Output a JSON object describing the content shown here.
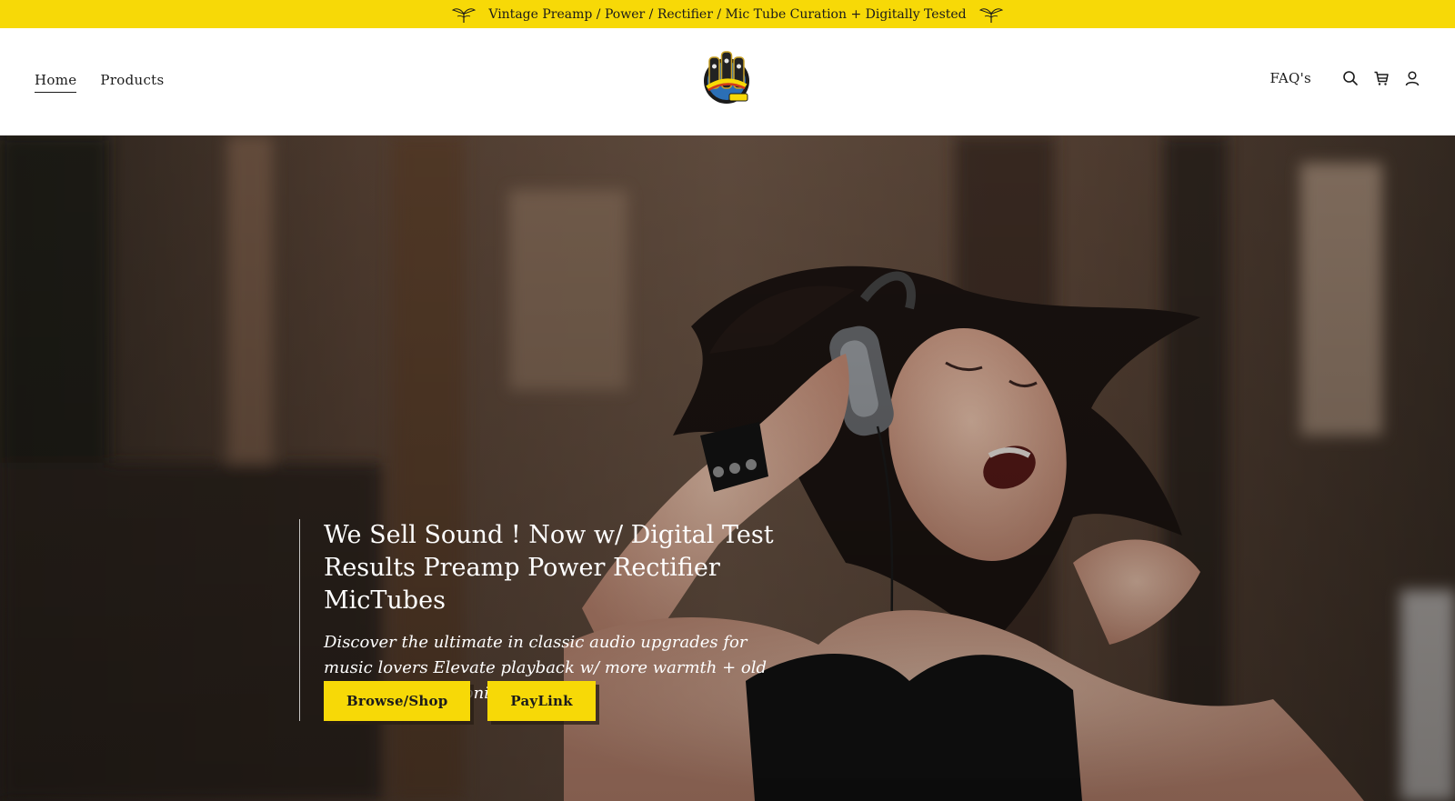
{
  "announcement": {
    "text": "Vintage Preamp / Power / Rectifier / Mic Tube Curation + Digitally Tested",
    "icon": "leaf-sprout-icon"
  },
  "header": {
    "nav_left": [
      {
        "label": "Home",
        "active": true
      },
      {
        "label": "Products",
        "active": false
      }
    ],
    "logo_icon": "tubes-logo-icon",
    "nav_right": {
      "faq_label": "FAQ's",
      "icons": [
        "search-icon",
        "cart-icon",
        "account-icon"
      ]
    }
  },
  "hero": {
    "title": "We Sell Sound ! Now w/ Digital Test Results Preamp Power Rectifier MicTubes",
    "subtitle": "Discover the ultimate in classic audio upgrades for music lovers Elevate playback w/ more warmth + old school rich harmonics",
    "buttons": {
      "primary_label": "Browse/Shop",
      "secondary_label": "PayLink"
    }
  },
  "colors": {
    "accent": "#f7d907",
    "text_dark": "#1b1b1b",
    "hero_text": "#ffffff"
  }
}
